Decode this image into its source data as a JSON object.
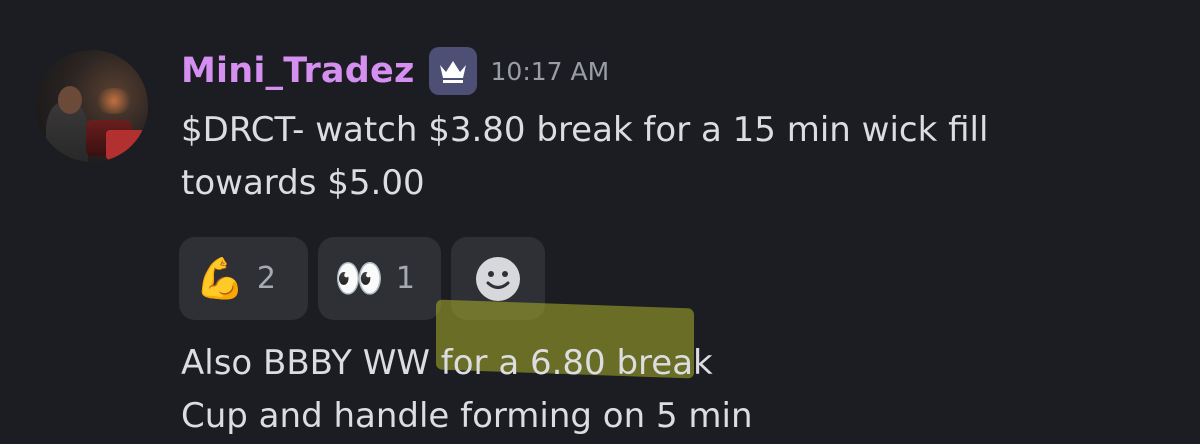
{
  "message": {
    "author": "Mini_Tradez",
    "author_color": "#d48ff0",
    "badge_icon": "crown-icon",
    "timestamp": "10:17 AM",
    "line1": "$DRCT- watch $3.80 break for a 15 min wick fill",
    "line2": "towards $5.00"
  },
  "reactions": [
    {
      "emoji": "💪",
      "icon": "flexed-biceps-icon",
      "count": "2"
    },
    {
      "emoji": "👀",
      "icon": "eyes-icon",
      "count": "1"
    },
    {
      "icon": "add-reaction-smiley-icon"
    }
  ],
  "message2": {
    "line1": "Also BBBY WW for a 6.80 break",
    "line2": "Cup and handle forming on 5 min"
  },
  "colors": {
    "background": "#1c1d22",
    "reaction_bg": "#2e3036",
    "highlight": "#aaaf28"
  }
}
